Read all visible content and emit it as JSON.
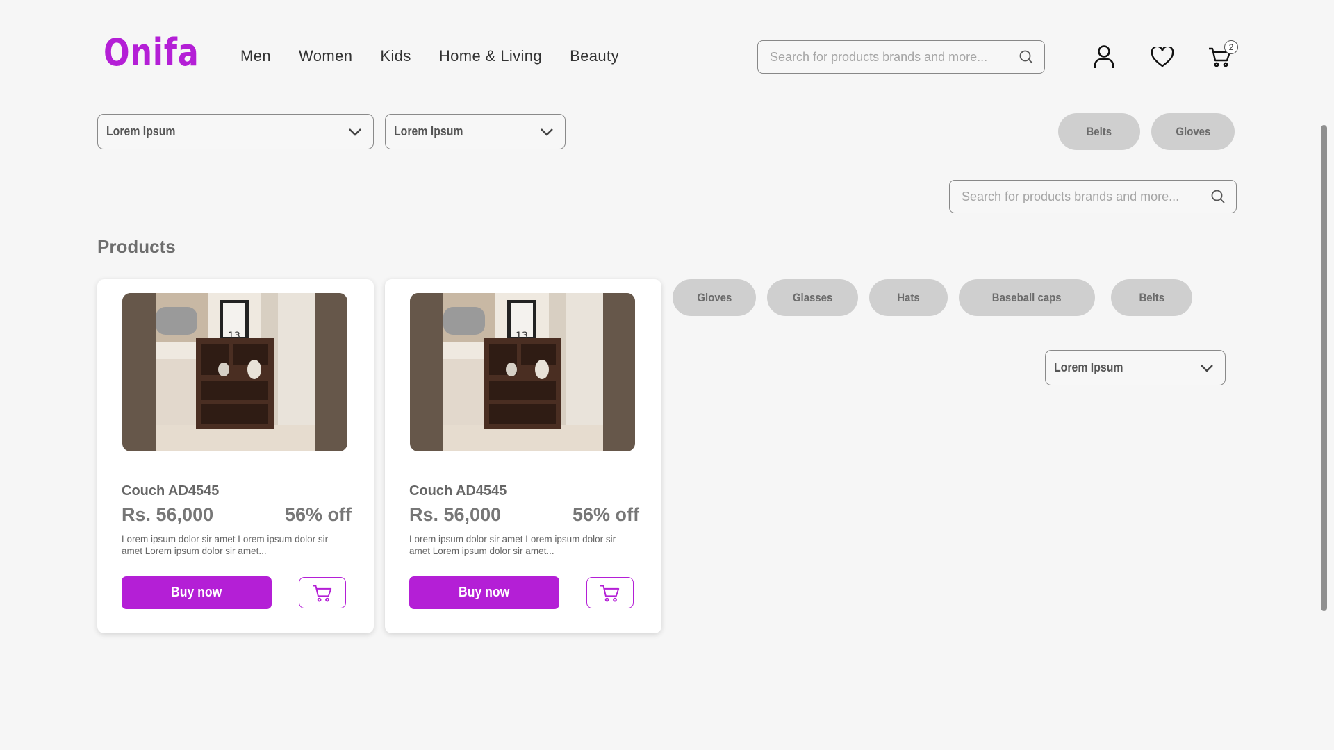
{
  "brand": {
    "logo": "Onifa",
    "accent": "#b41fd6"
  },
  "nav": [
    {
      "label": "Men"
    },
    {
      "label": "Women"
    },
    {
      "label": "Kids"
    },
    {
      "label": "Home & Living"
    },
    {
      "label": "Beauty"
    }
  ],
  "header": {
    "search_placeholder": "Search for products brands and more...",
    "icons": [
      "user-icon",
      "heart-icon",
      "cart-icon"
    ],
    "cart_count": "2"
  },
  "filters": {
    "dropdown1": "Lorem Ipsum",
    "dropdown2": "Lorem Ipsum",
    "dropdown3": "Lorem Ipsum",
    "top_chips": [
      {
        "label": "Belts"
      },
      {
        "label": "Gloves"
      }
    ],
    "search_placeholder": "Search for products brands and more...",
    "category_chips": [
      {
        "label": "Gloves"
      },
      {
        "label": "Glasses"
      },
      {
        "label": "Hats"
      },
      {
        "label": "Baseball caps"
      },
      {
        "label": "Belts"
      }
    ]
  },
  "products": {
    "title": "Products",
    "items": [
      {
        "name": "Couch AD4545",
        "price": "Rs. 56,000",
        "discount": "56% off",
        "description": "Lorem ipsum dolor sir amet Lorem ipsum dolor sir amet Lorem ipsum dolor sir amet...",
        "buy_label": "Buy now",
        "image_number": "13"
      },
      {
        "name": "Couch AD4545",
        "price": "Rs. 56,000",
        "discount": "56% off",
        "description": "Lorem ipsum dolor sir amet Lorem ipsum dolor sir amet Lorem ipsum dolor sir amet...",
        "buy_label": "Buy now",
        "image_number": "13"
      }
    ]
  }
}
